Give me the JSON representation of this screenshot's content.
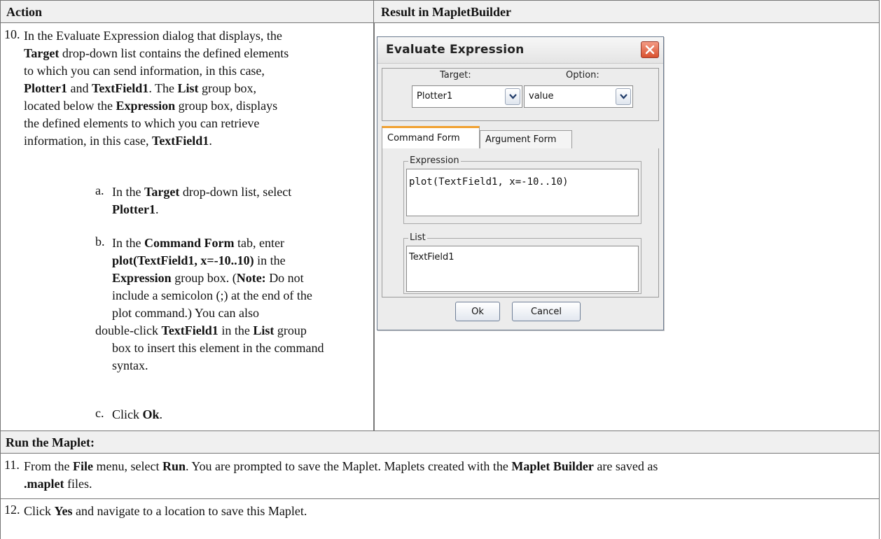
{
  "headers": {
    "action": "Action",
    "result": "Result in MapletBuilder"
  },
  "step10": {
    "num": "10.",
    "line1": "In the Evaluate Expression dialog that displays, the",
    "l2_b1": "Target",
    "l2_t1": " drop-down list contains the defined elements",
    "line3": "to which you can send information, in this case,",
    "l4_b1": "Plotter1",
    "l4_t1": " and ",
    "l4_b2": "TextField1",
    "l4_t2": ". The ",
    "l4_b3": "List",
    "l4_t3": " group box,",
    "l5_t1": "located below the ",
    "l5_b1": "Expression",
    "l5_t2": " group box, displays",
    "line6": "the defined elements to which you can retrieve",
    "l7_t1": "information, in this case, ",
    "l7_b1": "TextField1",
    "l7_t2": "."
  },
  "sub_a": {
    "letter": "a.",
    "l1_t1": "In the ",
    "l1_b1": "Target",
    "l1_t2": " drop-down list, select",
    "l2_b1": "Plotter1",
    "l2_t1": "."
  },
  "sub_b": {
    "letter": "b.",
    "l1_t1": "In the ",
    "l1_b1": "Command Form",
    "l1_t2": " tab, enter",
    "l2_b1": "plot(TextField1, x=-10..10)",
    "l2_t1": " in the",
    "l3_b1": "Expression",
    "l3_t1": " group box. (",
    "l3_b2": "Note:",
    "l3_t2": " Do not",
    "line4": "include a semicolon (;) at the end of the",
    "line5": "plot command.) You can also",
    "l6_t1": "double-click ",
    "l6_b1": "TextField1",
    "l6_t2": " in the ",
    "l6_b2": "List",
    "l6_t3": " group",
    "line7": "box to insert this element in the command",
    "line8": "syntax."
  },
  "sub_c": {
    "letter": "c.",
    "t1": "Click ",
    "b1": "Ok",
    "t2": "."
  },
  "run_heading": "Run the Maplet:",
  "step11": {
    "num": "11.",
    "t1": "From the ",
    "b1": "File",
    "t2": " menu, select ",
    "b2": "Run",
    "t3": ". You are prompted to save the Maplet. Maplets created with the ",
    "b3": "Maplet Builder",
    "t4": " are saved as",
    "l2_b1": ".maplet",
    "l2_t1": " files."
  },
  "step12": {
    "num": "12.",
    "t1": "Click ",
    "b1": "Yes",
    "t2": " and navigate to a location to save this Maplet."
  },
  "dialog": {
    "title": "Evaluate Expression",
    "target_label": "Target:",
    "option_label": "Option:",
    "target_value": "Plotter1",
    "option_value": "value",
    "tab_command": "Command Form",
    "tab_argument": "Argument Form",
    "expression_label": "Expression",
    "expression_value": "plot(TextField1, x=-10..10)",
    "list_label": "List",
    "list_item": "TextField1",
    "ok": "Ok",
    "cancel": "Cancel"
  }
}
